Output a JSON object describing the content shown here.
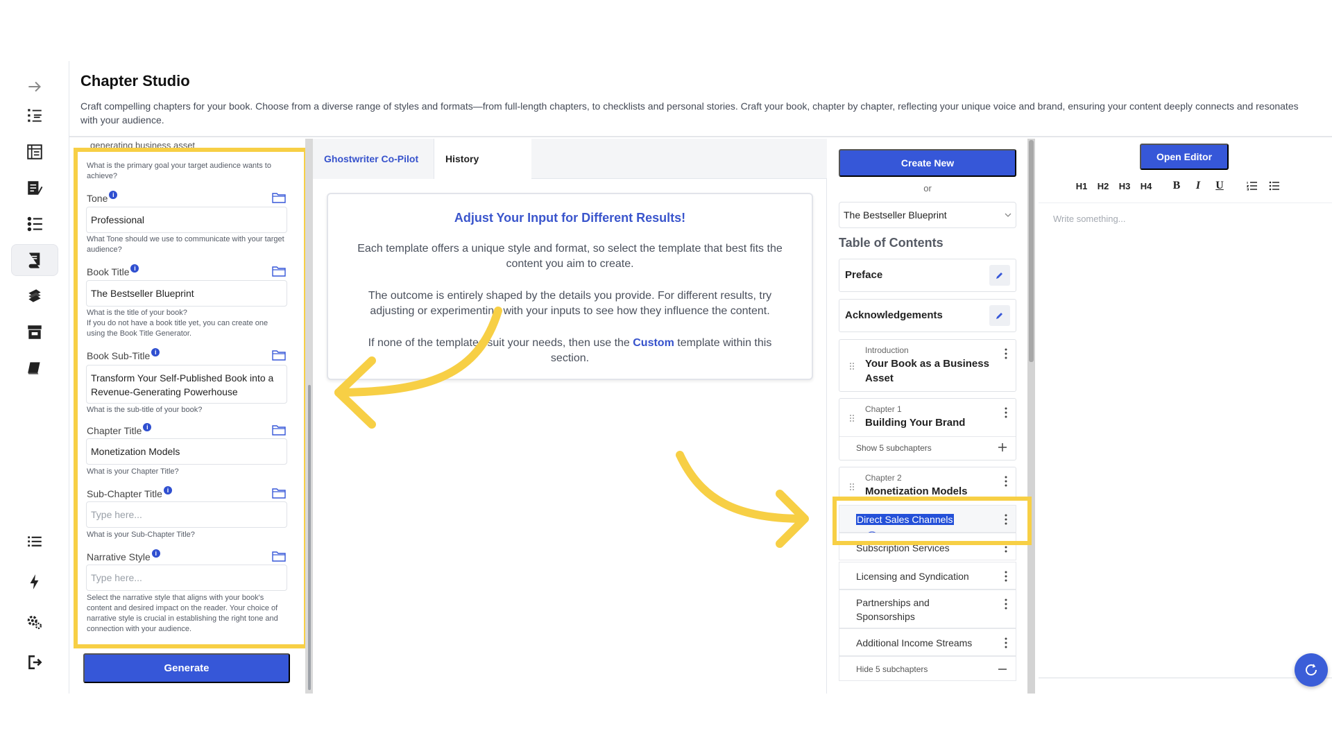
{
  "header": {
    "title": "Chapter Studio",
    "subtitle": "Craft compelling chapters for your book. Choose from a diverse range of styles and formats—from full-length chapters, to checklists and personal stories. Craft your book, chapter by chapter, reflecting your unique voice and brand, ensuring your content deeply connects and resonates with your audience."
  },
  "rail": {
    "icons": [
      "arrow-right-icon",
      "outline-list-icon",
      "book-layout-icon",
      "notebook-pen-icon",
      "numbered-list-icon",
      "book-active-icon",
      "book-stack-icon",
      "archive-icon",
      "book-closed-icon",
      "list-icon",
      "lightning-icon",
      "settings-icon",
      "logout-icon"
    ]
  },
  "form": {
    "cut_text": "generating business asset",
    "goal_help": "What is the primary goal your target audience wants to achieve?",
    "tone": {
      "label": "Tone",
      "value": "Professional",
      "help": "What Tone should we use to communicate with your target audience?"
    },
    "book_title": {
      "label": "Book Title",
      "value": "The Bestseller Blueprint",
      "help": "What is the title of your book?\nIf you do not have a book title yet, you can create one using the Book Title Generator."
    },
    "book_subtitle": {
      "label": "Book Sub-Title",
      "value": "Transform Your Self-Published Book into a Revenue-Generating Powerhouse",
      "help": "What is the sub-title of your book?"
    },
    "chapter_title": {
      "label": "Chapter Title",
      "value": "Monetization Models",
      "help": "What is your Chapter Title?"
    },
    "subchapter_title": {
      "label": "Sub-Chapter Title",
      "placeholder": "Type here...",
      "help": "What is your Sub-Chapter Title?"
    },
    "narrative_style": {
      "label": "Narrative Style",
      "placeholder": "Type here...",
      "help": "Select the narrative style that aligns with your book's content and desired impact on the reader. Your choice of narrative style is crucial in establishing the right tone and connection with your audience."
    },
    "info_glyph": "i",
    "generate_label": "Generate"
  },
  "middle": {
    "tabs": [
      "Ghostwriter Co-Pilot",
      "History"
    ],
    "notice": {
      "title": "Adjust Your Input for Different Results!",
      "p1": "Each template offers a unique style and format, so select the template that best fits the content you aim to create.",
      "p2": "The outcome is entirely shaped by the details you provide. For different results, try adjusting or experimenting with your inputs to see how they influence the content.",
      "p3_before": "If none of the templates suit your needs, then use the ",
      "p3_link": "Custom",
      "p3_after": " template within this section."
    }
  },
  "toc": {
    "create_label": "Create New",
    "or_label": "or",
    "selected_book": "The Bestseller Blueprint",
    "heading": "Table of Contents",
    "preface": "Preface",
    "acknowledgements": "Acknowledgements",
    "intro": {
      "kicker": "Introduction",
      "title": "Your Book as a Business Asset"
    },
    "chapter1": {
      "kicker": "Chapter 1",
      "title": "Building Your Brand",
      "toggle": "Show 5 subchapters"
    },
    "chapter2": {
      "kicker": "Chapter 2",
      "title": "Monetization Models",
      "toggle": "Hide 5 subchapters"
    },
    "subchapters": [
      "Direct Sales Channels",
      "Subscription Services",
      "Licensing and Syndication",
      "Partnerships and Sponsorships",
      "Additional Income Streams"
    ]
  },
  "editor": {
    "open_label": "Open Editor",
    "toolbar": [
      "H1",
      "H2",
      "H3",
      "H4",
      "B",
      "I",
      "U"
    ],
    "placeholder": "Write something..."
  },
  "colors": {
    "accent": "#3657d8",
    "highlight": "#f7cf45"
  }
}
